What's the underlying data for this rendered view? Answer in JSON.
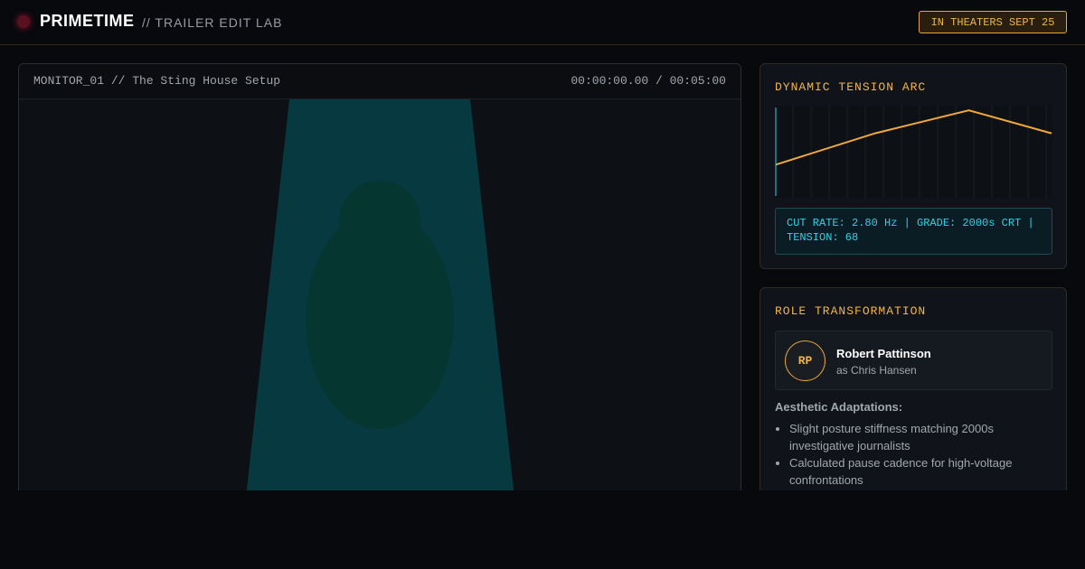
{
  "header": {
    "brand": "PRIMETIME",
    "subtitle": "// TRAILER EDIT LAB",
    "release_badge": "IN THEATERS SEPT 25",
    "rec_indicator_color": "#5a1020"
  },
  "monitor": {
    "title": "MONITOR_01 // The Sting House Setup",
    "timecode": "00:00:00.00 / 00:05:00",
    "colors": {
      "background": "#0d1116",
      "spotlight": "#063a40",
      "silhouette": "#053630"
    }
  },
  "tension": {
    "title": "DYNAMIC TENSION ARC",
    "readout": "CUT RATE: 2.80 Hz | GRADE: 2000s CRT | TENSION: 68",
    "line_color": "#f0a83a",
    "playhead_color": "#2ad4e8"
  },
  "chart_data": {
    "type": "line",
    "title": "",
    "xlabel": "",
    "ylabel": "",
    "x": [
      0,
      0.36,
      0.7,
      1.0
    ],
    "series": [
      {
        "name": "",
        "values": [
          0.36,
          0.7,
          0.95,
          0.7
        ]
      }
    ],
    "ylim": [
      0,
      1
    ],
    "grid": true
  },
  "role": {
    "title": "ROLE TRANSFORMATION",
    "avatar_initials": "RP",
    "actor_name": "Robert Pattinson",
    "character": "as Chris Hansen",
    "adaptations_title": "Aesthetic Adaptations:",
    "adaptations": [
      "Slight posture stiffness matching 2000s investigative journalists",
      "Calculated pause cadence for high-voltage confrontations"
    ]
  }
}
